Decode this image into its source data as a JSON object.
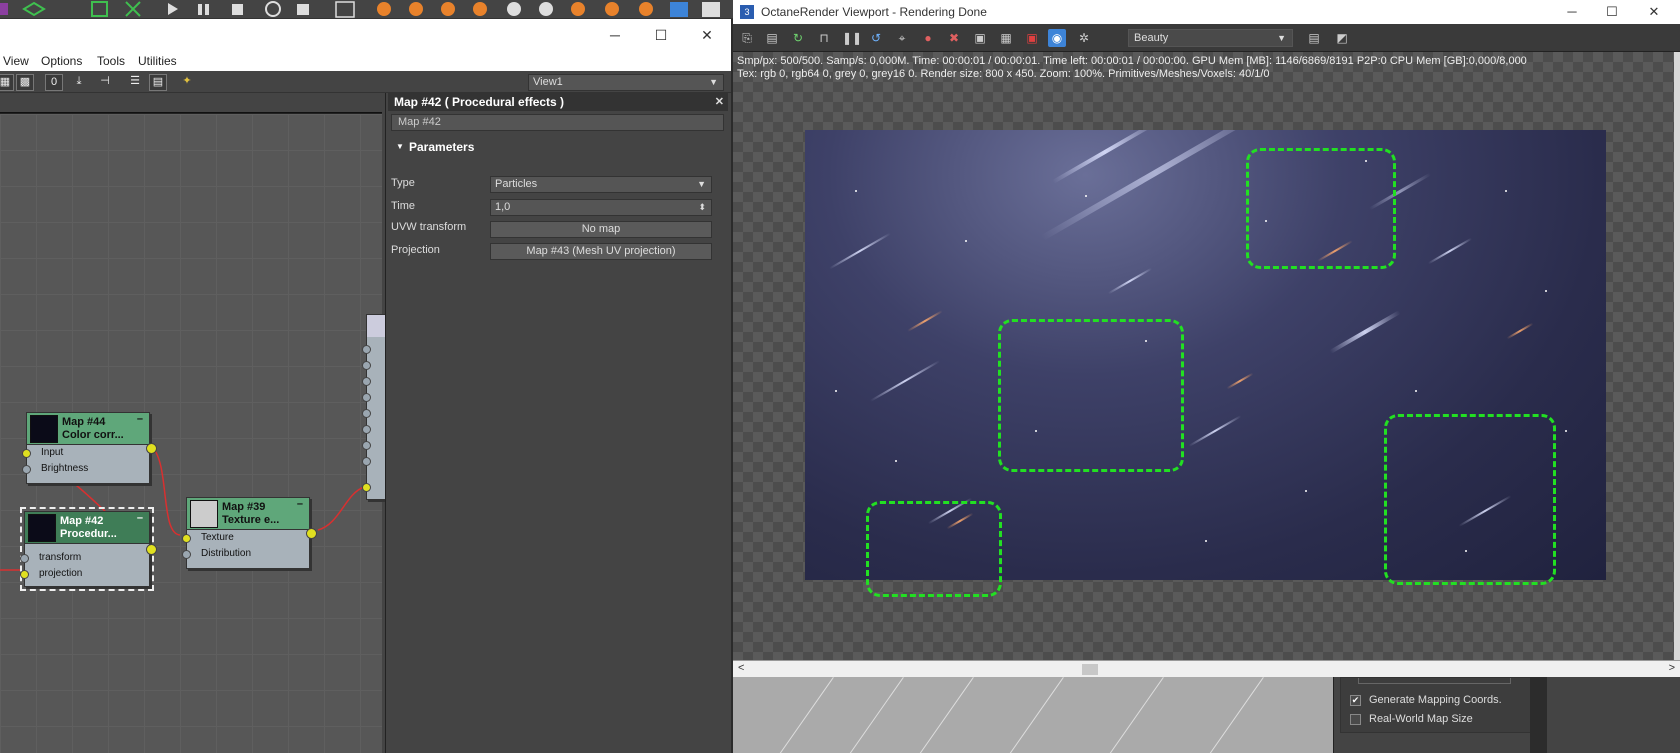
{
  "slate": {
    "menu": [
      "View",
      "Options",
      "Tools",
      "Utilities"
    ],
    "view_select": "View1",
    "window_controls": [
      "─",
      "☐",
      "✕"
    ]
  },
  "nodes": {
    "map44": {
      "title_line1": "Map #44",
      "title_line2": "Color corr...",
      "slots": [
        "Input",
        "Brightness"
      ]
    },
    "map42": {
      "title_line1": "Map #42",
      "title_line2": "Procedur...",
      "slots": [
        "transform",
        "projection"
      ]
    },
    "map39": {
      "title_line1": "Map #39",
      "title_line2": "Texture e...",
      "slots": [
        "Texture",
        "Distribution"
      ]
    }
  },
  "params": {
    "header": "Map #42  ( Procedural effects )",
    "name": "Map #42",
    "rollout": "Parameters",
    "type_label": "Type",
    "type_value": "Particles",
    "time_label": "Time",
    "time_value": "1,0",
    "uvw_label": "UVW transform",
    "uvw_value": "No map",
    "projection_label": "Projection",
    "projection_value": "Map #43 (Mesh UV projection)"
  },
  "octane": {
    "title": "OctaneRender Viewport - Rendering Done",
    "app_icon": "3",
    "pass": "Beauty",
    "info1": "Smp/px: 500/500.   Samp/s: 0,000M.   Time: 00:00:01 / 00:00:01.   Time left: 00:00:01 / 00:00:00.   GPU Mem [MB]: 1146/6869/8191 P2P:0   CPU Mem [GB]:0,000/8,000",
    "info2": "Tex: rgb 0, rgb64 0, grey 0, grey16 0.   Render size: 800 x 450.   Zoom: 100%.   Primitives/Meshes/Voxels: 40/1/0"
  },
  "rollout_below": {
    "generate_mapping": "Generate Mapping Coords.",
    "real_world": "Real-World Map Size",
    "generate_checked": true,
    "real_world_checked": false
  },
  "colors": {
    "highlight": "#22e022",
    "accent": "#3d84d8",
    "node_green": "#5fa77a",
    "wire": "#d83030"
  }
}
